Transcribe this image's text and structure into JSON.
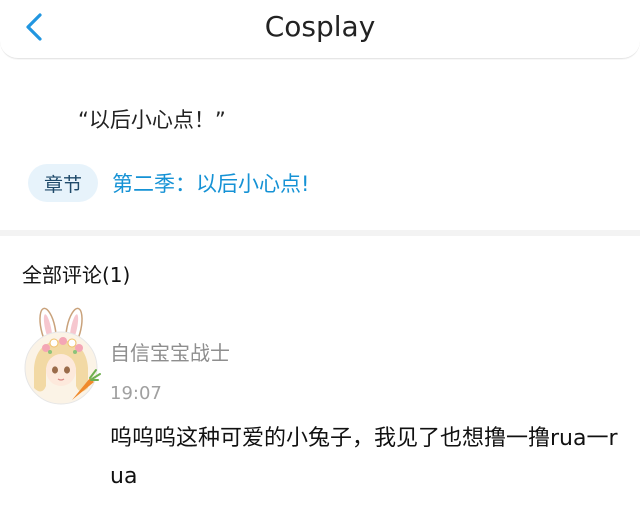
{
  "header": {
    "title": "Cosplay",
    "back_icon": "chevron-left-icon"
  },
  "post": {
    "quote": "“以后小心点！”",
    "chapter_tag": "章节",
    "chapter_title": "第二季：以后小心点!"
  },
  "comments": {
    "title": "全部评论(1)",
    "items": [
      {
        "user": "自信宝宝战士",
        "time": "19:07",
        "text": "呜呜呜这种可爱的小兔子，我见了也想撸一撸rua一rua"
      }
    ]
  },
  "colors": {
    "accent": "#1592d5",
    "tag_bg": "#e7f3fb",
    "muted_text": "#8e8e8e"
  }
}
